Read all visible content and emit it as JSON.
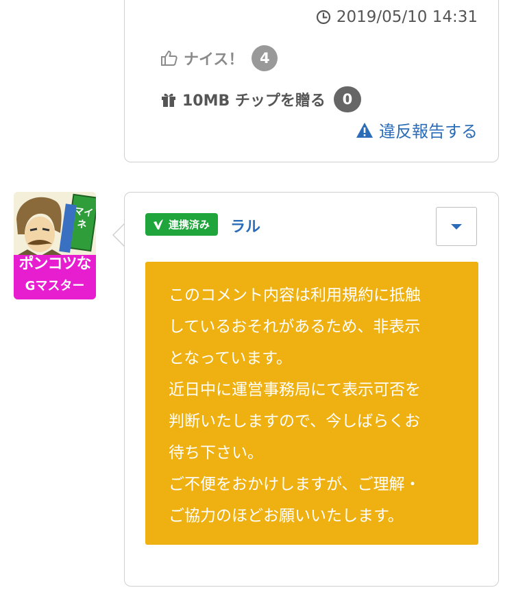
{
  "previous_comment": {
    "timestamp": "2019/05/10 14:31",
    "nice_label": "ナイス！",
    "nice_count": "4",
    "chip_label": "10MB チップを贈る",
    "chip_count": "0",
    "report_label": "違反報告する"
  },
  "comment": {
    "avatar": {
      "caption": "ポンコツな",
      "rank": "Gマスター",
      "sign_text": "マイネ君がんばれ♪"
    },
    "linked_label": "連携済み",
    "username": "ラル",
    "notice_lines": [
      "このコメント内容は利用規約に抵触",
      "しているおそれがあるため、非表示",
      "となっています。",
      "近日中に運営事務局にて表示可否を",
      "判断いたしますので、今しばらくお",
      "待ち下さい。",
      "ご不便をおかけしますが、ご理解・",
      "ご協力のほどお願いいたします。"
    ]
  },
  "colors": {
    "link": "#2a6cb8",
    "linked_green": "#1fa53b",
    "notice_yellow": "#eeb111",
    "avatar_magenta": "#e61ecf"
  }
}
